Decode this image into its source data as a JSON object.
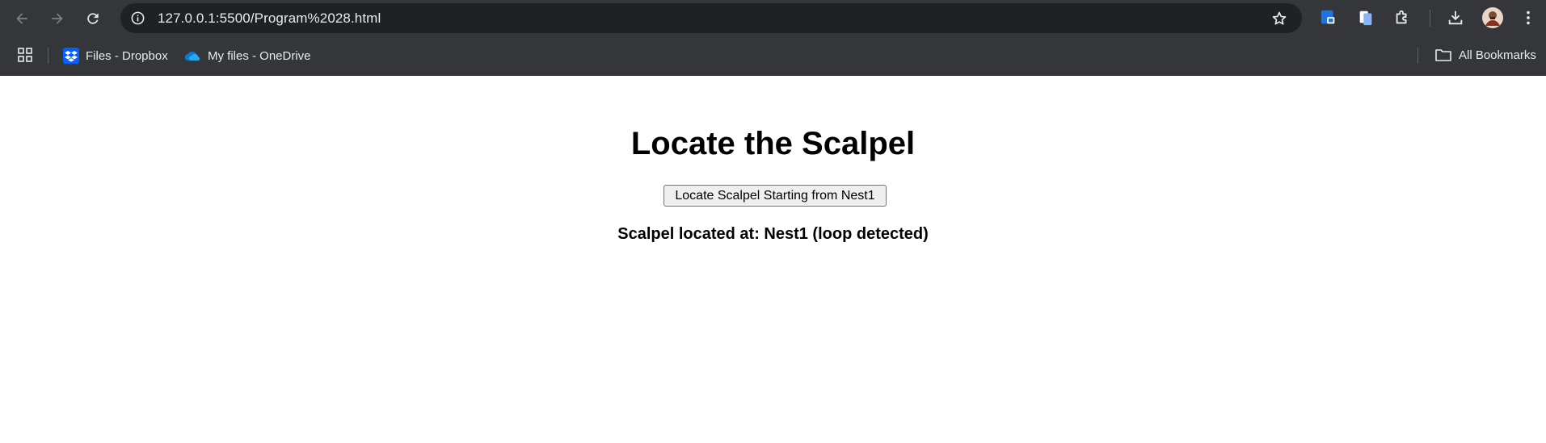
{
  "browser": {
    "url": "127.0.0.1:5500/Program%2028.html",
    "bookmarks": [
      {
        "label": "Files - Dropbox",
        "icon": "dropbox-icon"
      },
      {
        "label": "My files - OneDrive",
        "icon": "onedrive-icon"
      }
    ],
    "all_bookmarks_label": "All Bookmarks"
  },
  "page": {
    "title": "Locate the Scalpel",
    "button_label": "Locate Scalpel Starting from Nest1",
    "result_text": "Scalpel located at: Nest1 (loop detected)"
  },
  "colors": {
    "chrome_bg": "#35363a",
    "omnibox_bg": "#202124",
    "page_bg": "#ffffff"
  }
}
